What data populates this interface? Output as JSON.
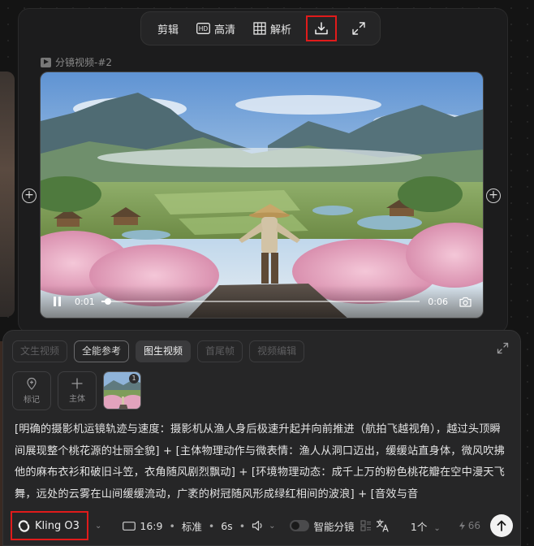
{
  "toolbar": {
    "edit_label": "剪辑",
    "hd_badge": "HD",
    "hd_label": "高清",
    "analyze_label": "解析",
    "download_icon": "download-icon",
    "fullscreen_icon": "expand-icon"
  },
  "clip": {
    "title": "分镜视频-#2",
    "current_time": "0:01",
    "duration": "0:06",
    "progress": 0.02
  },
  "panel": {
    "tabs": [
      {
        "label": "文生视频",
        "state": "disabled"
      },
      {
        "label": "全能参考",
        "state": "outline"
      },
      {
        "label": "图生视频",
        "state": "selected"
      },
      {
        "label": "首尾帧",
        "state": "disabled"
      },
      {
        "label": "视频编辑",
        "state": "disabled"
      }
    ],
    "assets": {
      "mark_label": "标记",
      "subject_label": "主体",
      "thumb_count": "1"
    },
    "prompt": "[明确的摄影机运镜轨迹与速度：摄影机从渔人身后极速升起并向前推进（航拍飞越视角），越过头顶瞬间展现整个桃花源的壮丽全貌] + [主体物理动作与微表情：渔人从洞口迈出，缓缓站直身体，微风吹拂他的麻布衣衫和破旧斗笠，衣角随风剧烈飘动] + [环境物理动态：成千上万的粉色桃花瓣在空中漫天飞舞，远处的云雾在山间缓缓流动，广袤的树冠随风形成绿红相间的波浪] + [音效与音",
    "footer": {
      "model": "Kling O3",
      "ratio": "16:9",
      "quality": "标准",
      "length": "6s",
      "smart_label": "智能分镜",
      "count": "1个",
      "credits": "66"
    }
  },
  "colors": {
    "highlight": "#e01b1b",
    "background": "#141414",
    "panel": "#262627"
  }
}
